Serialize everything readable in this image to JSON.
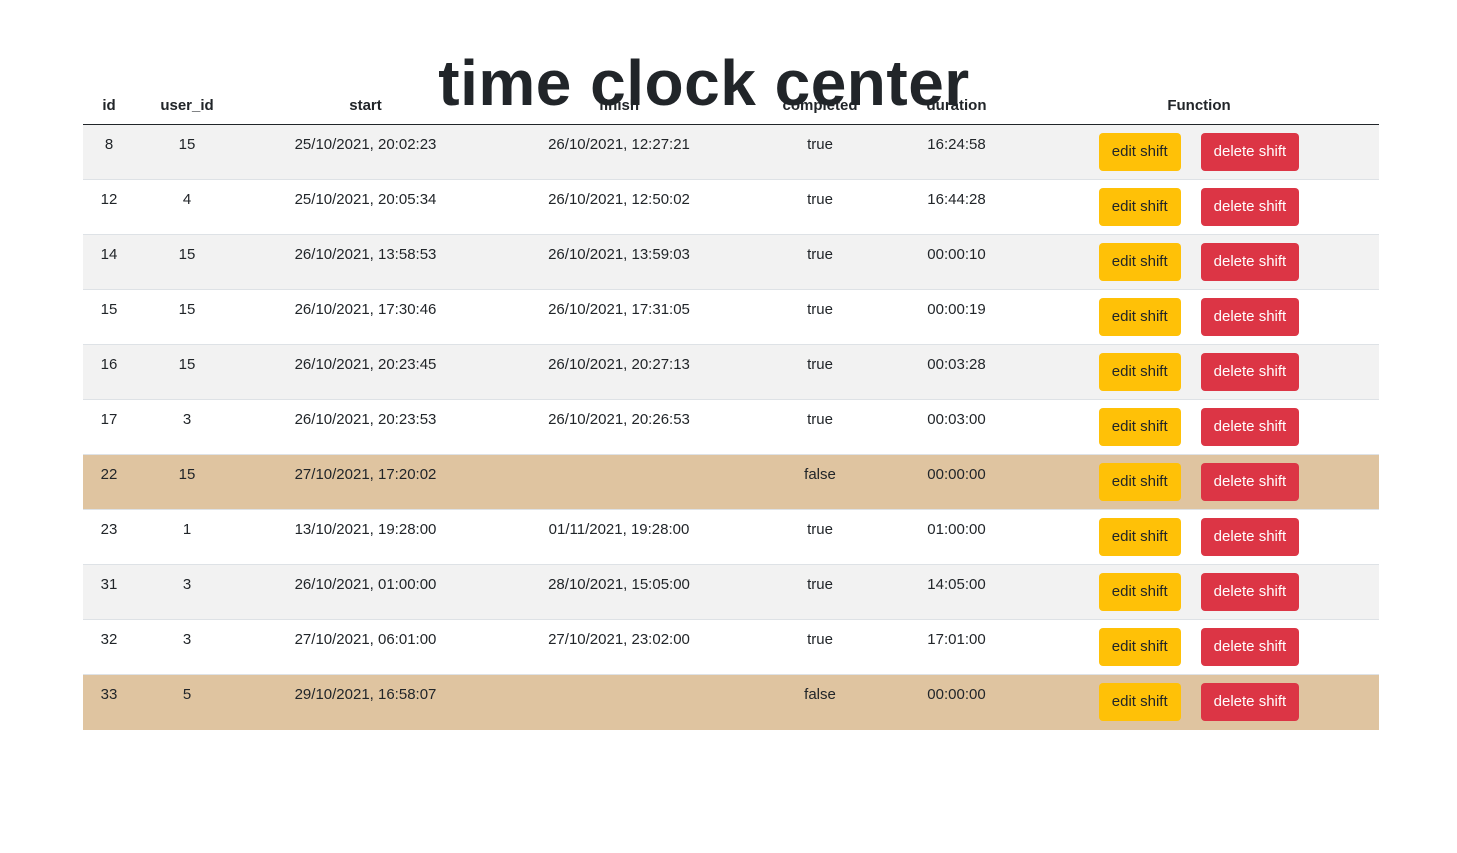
{
  "page": {
    "title": "time clock center"
  },
  "table": {
    "headers": {
      "id": "id",
      "user_id": "user_id",
      "start": "start",
      "finish": "finish",
      "completed": "completed",
      "duration": "duration",
      "function": "Function"
    },
    "edit_label": "edit shift",
    "delete_label": "delete shift",
    "rows": [
      {
        "id": "8",
        "user_id": "15",
        "start": "25/10/2021, 20:02:23",
        "finish": "26/10/2021, 12:27:21",
        "completed": "true",
        "duration": "16:24:58"
      },
      {
        "id": "12",
        "user_id": "4",
        "start": "25/10/2021, 20:05:34",
        "finish": "26/10/2021, 12:50:02",
        "completed": "true",
        "duration": "16:44:28"
      },
      {
        "id": "14",
        "user_id": "15",
        "start": "26/10/2021, 13:58:53",
        "finish": "26/10/2021, 13:59:03",
        "completed": "true",
        "duration": "00:00:10"
      },
      {
        "id": "15",
        "user_id": "15",
        "start": "26/10/2021, 17:30:46",
        "finish": "26/10/2021, 17:31:05",
        "completed": "true",
        "duration": "00:00:19"
      },
      {
        "id": "16",
        "user_id": "15",
        "start": "26/10/2021, 20:23:45",
        "finish": "26/10/2021, 20:27:13",
        "completed": "true",
        "duration": "00:03:28"
      },
      {
        "id": "17",
        "user_id": "3",
        "start": "26/10/2021, 20:23:53",
        "finish": "26/10/2021, 20:26:53",
        "completed": "true",
        "duration": "00:03:00"
      },
      {
        "id": "22",
        "user_id": "15",
        "start": "27/10/2021, 17:20:02",
        "finish": "",
        "completed": "false",
        "duration": "00:00:00"
      },
      {
        "id": "23",
        "user_id": "1",
        "start": "13/10/2021, 19:28:00",
        "finish": "01/11/2021, 19:28:00",
        "completed": "true",
        "duration": "01:00:00"
      },
      {
        "id": "31",
        "user_id": "3",
        "start": "26/10/2021, 01:00:00",
        "finish": "28/10/2021, 15:05:00",
        "completed": "true",
        "duration": "14:05:00"
      },
      {
        "id": "32",
        "user_id": "3",
        "start": "27/10/2021, 06:01:00",
        "finish": "27/10/2021, 23:02:00",
        "completed": "true",
        "duration": "17:01:00"
      },
      {
        "id": "33",
        "user_id": "5",
        "start": "29/10/2021, 16:58:07",
        "finish": "",
        "completed": "false",
        "duration": "00:00:00"
      }
    ]
  },
  "colors": {
    "edit_button": "#ffc107",
    "delete_button": "#dc3545",
    "incomplete_row": "#dfc4a0",
    "striped_row": "#f2f2f2"
  }
}
